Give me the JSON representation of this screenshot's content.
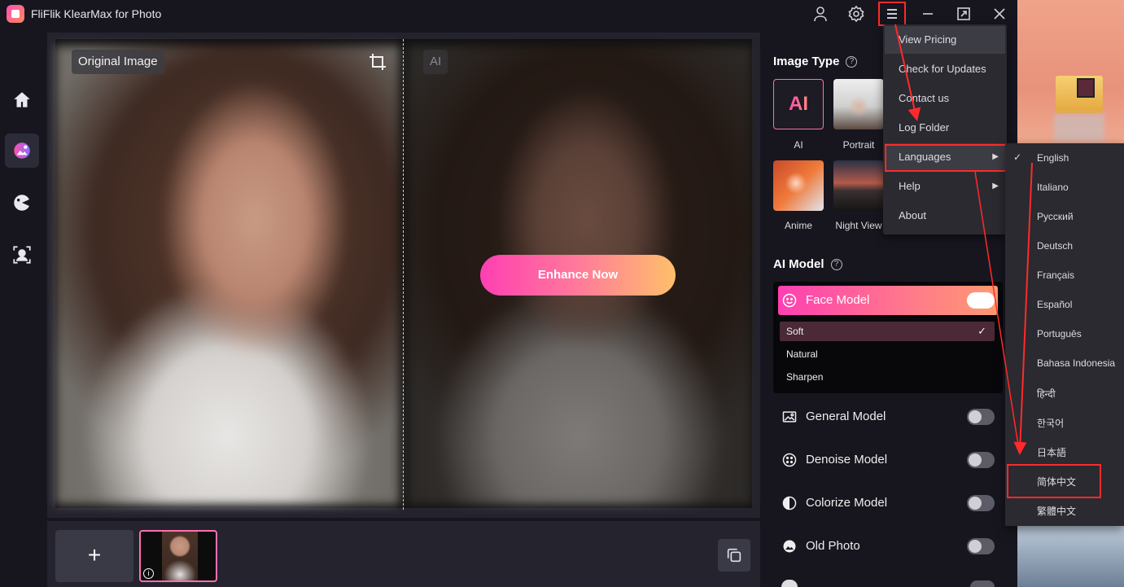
{
  "app": {
    "title": "FliFlik KlearMax for Photo"
  },
  "titlebar": {
    "icons": [
      "user-icon",
      "settings-icon",
      "menu-icon",
      "minimize-icon",
      "maximize-icon",
      "close-icon"
    ]
  },
  "leftnav": {
    "items": [
      "home-icon",
      "photo-enhance-icon",
      "colorize-icon",
      "face-detect-icon"
    ]
  },
  "preview": {
    "original_label": "Original Image",
    "ai_label": "AI",
    "enhance_button": "Enhance Now"
  },
  "bottom": {
    "add_label": "+",
    "info_label": "i"
  },
  "image_type": {
    "title": "Image Type",
    "help": "?",
    "cards": [
      {
        "label": "AI",
        "badge": "AI"
      },
      {
        "label": "Portrait"
      },
      {
        "label": "Anime"
      },
      {
        "label": "Night View"
      }
    ]
  },
  "ai_model": {
    "title": "AI Model",
    "help": "?",
    "face_model": {
      "label": "Face Model",
      "enabled": true,
      "options": [
        "Soft",
        "Natural",
        "Sharpen"
      ],
      "selected": "Soft"
    },
    "models": [
      {
        "label": "General Model",
        "enabled": false
      },
      {
        "label": "Denoise Model",
        "enabled": false
      },
      {
        "label": "Colorize Model",
        "enabled": false
      },
      {
        "label": "Old Photo",
        "enabled": false
      }
    ]
  },
  "menu": {
    "items": [
      "View Pricing",
      "Check for Updates",
      "Contact us",
      "Log Folder",
      "Languages",
      "Help",
      "About"
    ],
    "languages": [
      "English",
      "Italiano",
      "Русский",
      "Deutsch",
      "Français",
      "Español",
      "Português",
      "Bahasa Indonesia",
      "हिन्दी",
      "한국어",
      "日本語",
      "简体中文",
      "繁體中文"
    ],
    "selected_language": "English"
  },
  "colors": {
    "accent_pink": "#ff3fb2",
    "highlight_red": "#ff2a2a",
    "panel_bg": "#17161f"
  }
}
